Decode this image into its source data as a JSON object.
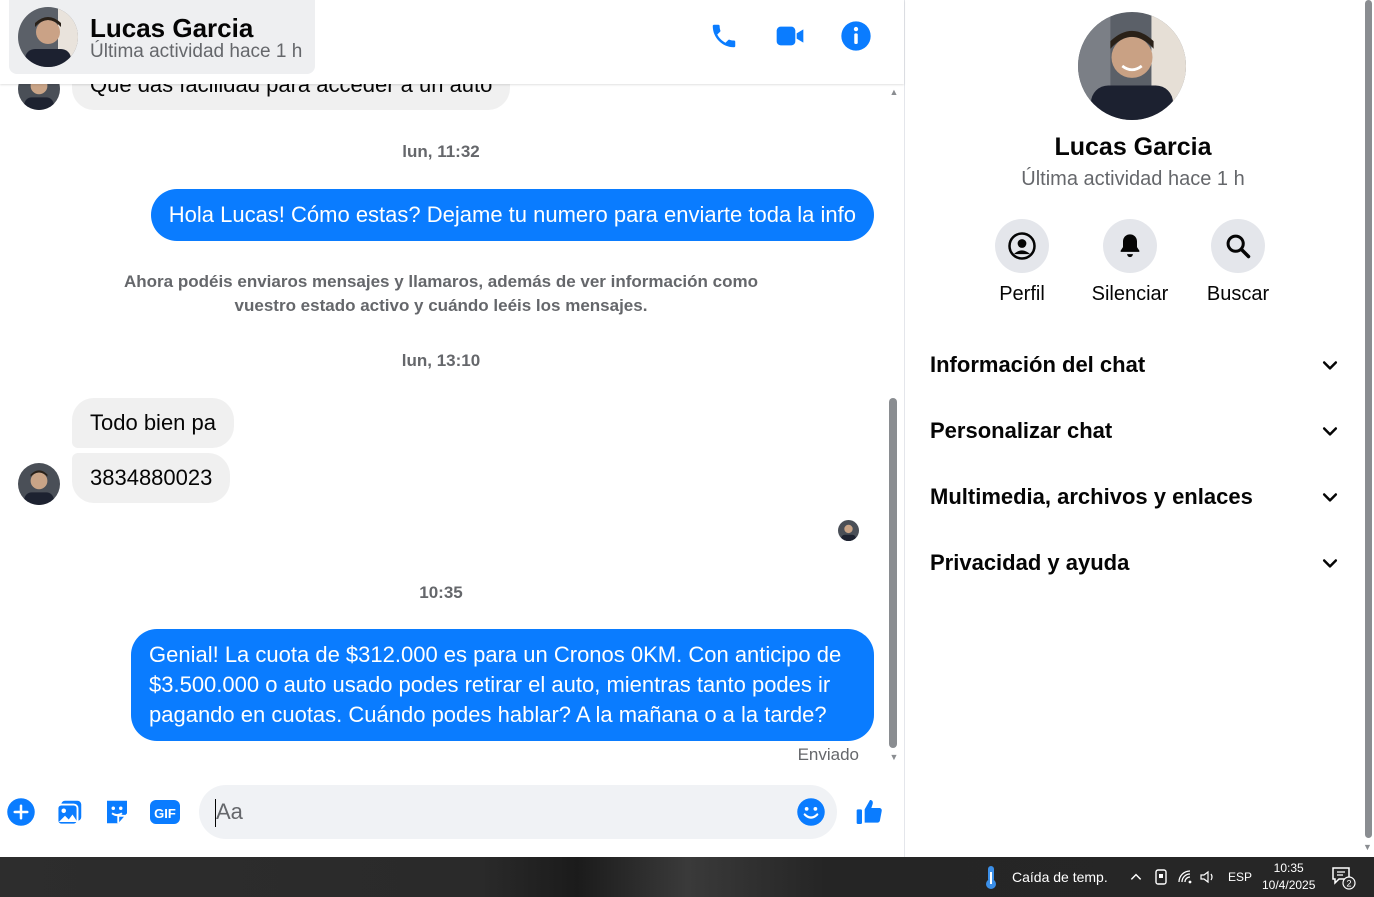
{
  "header": {
    "name": "Lucas Garcia",
    "status": "Última actividad hace 1 h"
  },
  "messages": {
    "partial_incoming": "Que das facilidad para acceder a un auto",
    "time_1": "lun, 11:32",
    "outgoing_1": "Hola Lucas! Cómo estas? Dejame tu numero para enviarte toda la info",
    "system_notice": "Ahora podéis enviaros mensajes y llamaros, además de ver información como vuestro estado activo y cuándo leéis los mensajes.",
    "time_2": "lun, 13:10",
    "incoming_1": "Todo bien pa",
    "incoming_2": "3834880023",
    "time_3": "10:35",
    "outgoing_2": "Genial! La cuota de $312.000 es para un Cronos 0KM. Con anticipo de $3.500.000 o auto usado podes retirar el auto, mientras tanto podes ir pagando en cuotas. Cuándo podes hablar? A la mañana o a la tarde?",
    "sent_status": "Enviado"
  },
  "composer": {
    "placeholder": "Aa",
    "gif_label": "GIF"
  },
  "panel": {
    "name": "Lucas Garcia",
    "status": "Última actividad hace 1 h",
    "actions": [
      {
        "label": "Perfil",
        "icon": "profile-icon"
      },
      {
        "label": "Silenciar",
        "icon": "bell-icon"
      },
      {
        "label": "Buscar",
        "icon": "search-icon"
      }
    ],
    "sections": [
      "Información del chat",
      "Personalizar chat",
      "Multimedia, archivos y enlaces",
      "Privacidad y ayuda"
    ]
  },
  "taskbar": {
    "weather": "Caída de temp.",
    "language": "ESP",
    "time": "10:35",
    "date": "10/4/2025",
    "notification_count": "2"
  },
  "colors": {
    "accent": "#0a7cff",
    "bubble_in": "#f0f0f0",
    "secondary_text": "#65676b"
  }
}
